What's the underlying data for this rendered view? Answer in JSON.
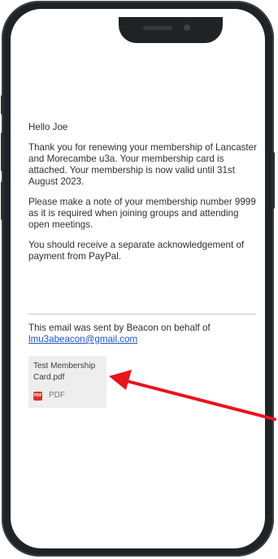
{
  "email": {
    "greeting": "Hello Joe",
    "paragraphs": [
      "Thank you for renewing your membership of Lancaster and Morecambe u3a.  Your membership card is attached.  Your membership is now valid until 31st August 2023.",
      "Please make a note of your membership number 9999 as it is required when joining groups and attending open meetings.",
      "You should receive a separate acknowledgement of payment from PayPal."
    ],
    "footer_text": "This email was sent by Beacon on behalf of",
    "footer_email": "lmu3abeacon@gmail.com"
  },
  "attachment": {
    "name": "Test Membership Card.pdf",
    "type_label": "PDF",
    "icon_text": "PDF"
  },
  "colors": {
    "arrow": "#e8141b",
    "link": "#1a56c8",
    "phone_frame": "#1f2326"
  },
  "icons": {
    "attachment_type": "pdf-icon",
    "annotation": "red-arrow-annotation"
  }
}
